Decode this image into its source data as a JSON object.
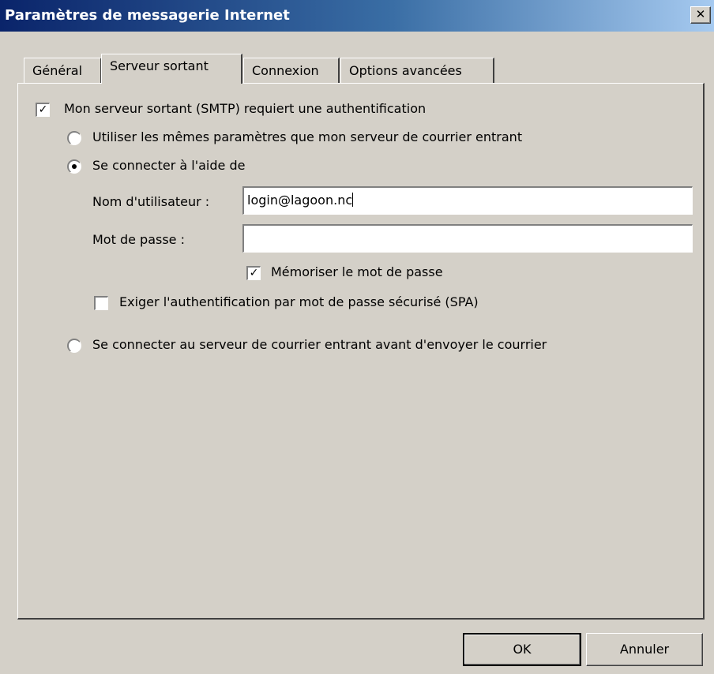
{
  "window": {
    "title": "Paramètres de messagerie Internet",
    "close_glyph": "✕"
  },
  "tabs": [
    {
      "label": "Général",
      "active": false
    },
    {
      "label": "Serveur sortant",
      "active": true
    },
    {
      "label": "Connexion",
      "active": false
    },
    {
      "label": "Options avancées",
      "active": false
    }
  ],
  "smtp": {
    "requires_auth_label": "Mon serveur sortant (SMTP) requiert une authentification",
    "requires_auth_checked": true,
    "option_same_settings_label": "Utiliser les mêmes paramètres que mon serveur de courrier entrant",
    "option_same_settings_selected": false,
    "option_login_label": "Se connecter à l'aide de",
    "option_login_selected": true,
    "username_label": "Nom d'utilisateur :",
    "username_value": "login@lagoon.nc",
    "password_label": "Mot de passe :",
    "password_value": "",
    "remember_password_label": "Mémoriser le mot de passe",
    "remember_password_checked": true,
    "spa_label": "Exiger l'authentification par mot de passe sécurisé (SPA)",
    "spa_checked": false,
    "option_incoming_first_label": "Se connecter au serveur de courrier entrant avant d'envoyer le courrier",
    "option_incoming_first_selected": false,
    "checkmark_glyph": "✓"
  },
  "buttons": {
    "ok_label": "OK",
    "cancel_label": "Annuler"
  }
}
